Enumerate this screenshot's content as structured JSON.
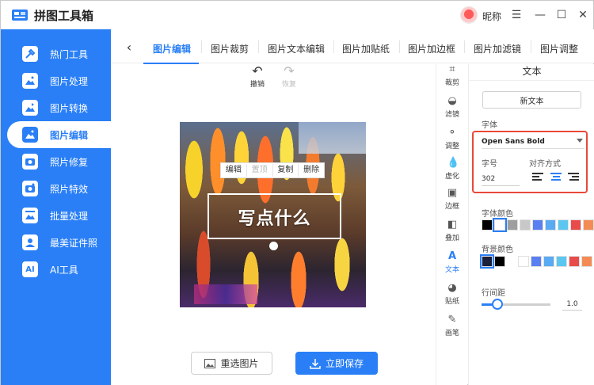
{
  "app": {
    "title": "拼图工具箱",
    "nickname": "昵称",
    "window_controls": [
      "menu-icon",
      "minimize-icon",
      "maximize-icon",
      "close-icon"
    ]
  },
  "sidebar": {
    "items": [
      {
        "label": "热门工具",
        "icon": "tools-icon"
      },
      {
        "label": "图片处理",
        "icon": "image-process-icon"
      },
      {
        "label": "图片转换",
        "icon": "image-convert-icon"
      },
      {
        "label": "图片编辑",
        "icon": "image-edit-icon",
        "active": true
      },
      {
        "label": "照片修复",
        "icon": "photo-repair-icon"
      },
      {
        "label": "照片特效",
        "icon": "photo-effect-icon"
      },
      {
        "label": "批量处理",
        "icon": "batch-icon"
      },
      {
        "label": "最美证件照",
        "icon": "id-photo-icon"
      },
      {
        "label": "AI工具",
        "icon": "ai-icon"
      }
    ],
    "accent_color": "#2a7ff6"
  },
  "tabs": {
    "items": [
      "图片编辑",
      "图片裁剪",
      "图片文本编辑",
      "图片加贴纸",
      "图片加边框",
      "图片加滤镜",
      "图片调整"
    ],
    "active": "图片编辑"
  },
  "history": {
    "undo_label": "撤销",
    "redo_label": "恢复"
  },
  "context_toolbar": {
    "edit": "编辑",
    "top": "置顶",
    "copy": "复制",
    "delete": "删除"
  },
  "text_overlay": {
    "text": "写点什么"
  },
  "actions": {
    "reselect_label": "重选图片",
    "save_label": "立即保存"
  },
  "tools": [
    {
      "label": "裁剪",
      "icon": "crop-icon"
    },
    {
      "label": "滤镜",
      "icon": "filter-icon"
    },
    {
      "label": "调整",
      "icon": "adjust-icon"
    },
    {
      "label": "虚化",
      "icon": "blur-icon"
    },
    {
      "label": "边框",
      "icon": "border-icon"
    },
    {
      "label": "叠加",
      "icon": "overlay-icon"
    },
    {
      "label": "文本",
      "icon": "text-icon",
      "active": true
    },
    {
      "label": "贴纸",
      "icon": "sticker-icon"
    },
    {
      "label": "画笔",
      "icon": "brush-icon"
    }
  ],
  "panel": {
    "title": "文本",
    "new_text_label": "新文本",
    "font_label": "字体",
    "font_value": "Open Sans Bold",
    "size_label": "字号",
    "size_value": "302",
    "align_label": "对齐方式",
    "align_selected": "center",
    "font_color_label": "字体颜色",
    "font_colors": [
      "#000000",
      "#ffffff",
      "#9e9e9e",
      "#c8c8c8",
      "#5a7ff0",
      "#58aaf2",
      "#5bc7f0",
      "#e94b4b",
      "#f48b55",
      "#f39c5a"
    ],
    "font_color_selected": "#ffffff",
    "bg_color_label": "背景颜色",
    "bg_colors": [
      "#1a1f3a",
      "#000000",
      "#ffffff",
      "#5a7ff0",
      "#58aaf2",
      "#5bc7f0",
      "#e94b4b",
      "#f48b55",
      "#f39c5a"
    ],
    "bg_color_selected": "#1a1f3a",
    "line_spacing_label": "行间距",
    "line_spacing_value": "1.0"
  }
}
